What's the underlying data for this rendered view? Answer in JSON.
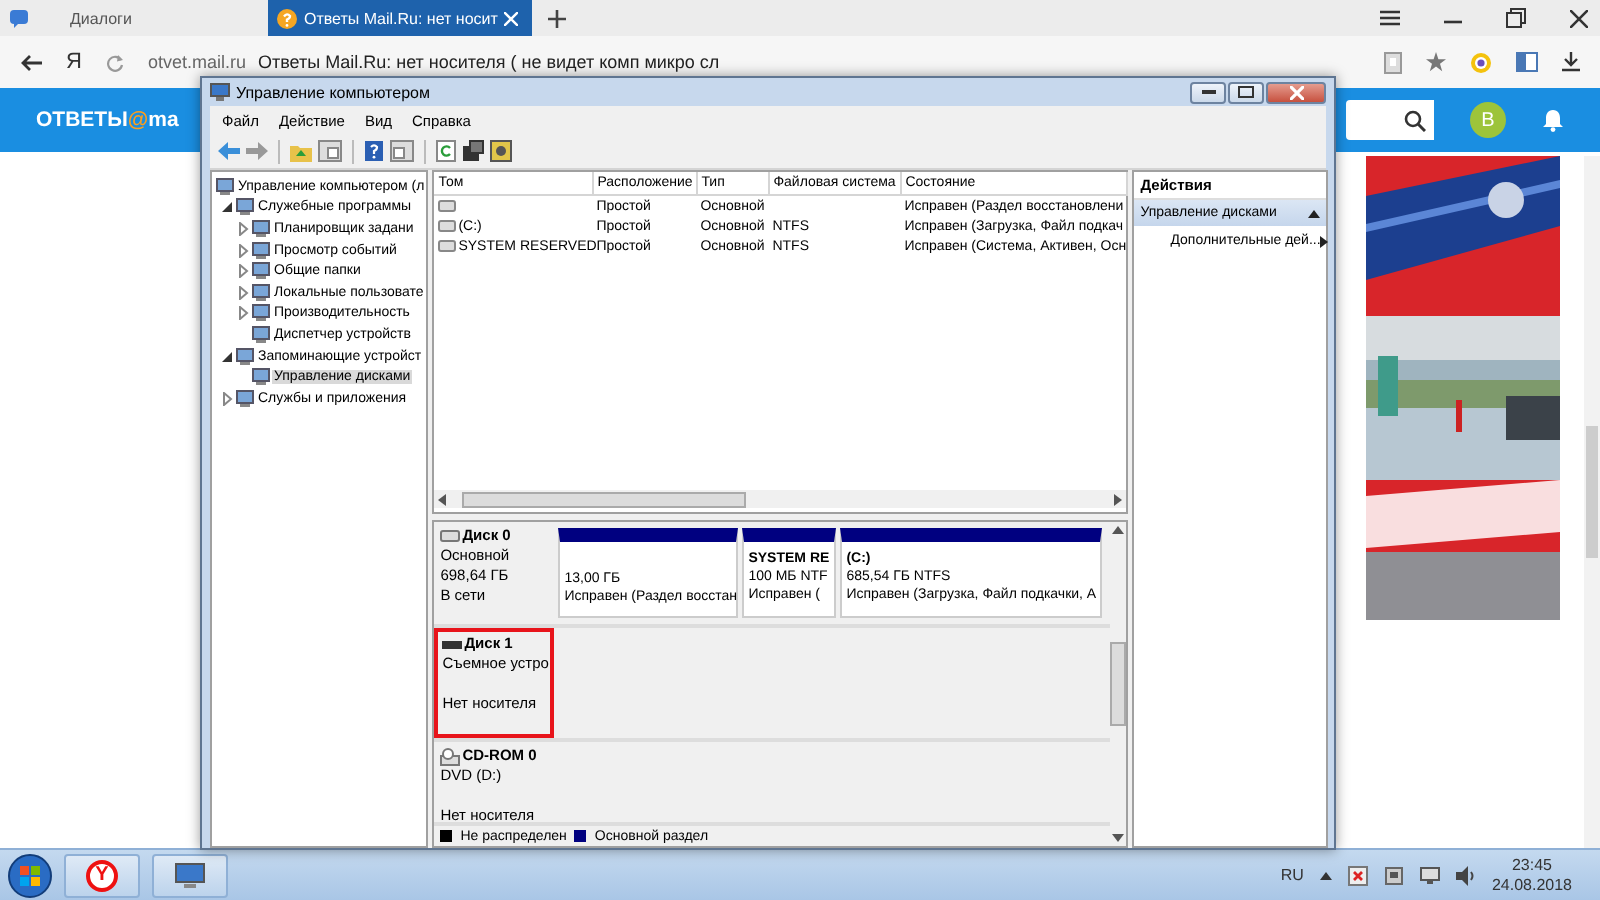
{
  "browser": {
    "tabs": [
      {
        "label": "Диалоги",
        "selected": false
      },
      {
        "label": "Ответы Mail.Ru: нет носит",
        "selected": true
      }
    ],
    "logo_letter": "Я",
    "domain": "otvet.mail.ru",
    "page_title": "Ответы Mail.Ru: нет носителя ( не видет комп микро сл",
    "site_logo": [
      "ОТВЕТЫ",
      "@",
      "ma"
    ],
    "avatar": "В"
  },
  "window": {
    "title": "Управление компьютером",
    "menu": [
      "Файл",
      "Действие",
      "Вид",
      "Справка"
    ],
    "tree": [
      {
        "label": "Управление компьютером (л",
        "selected": false,
        "children": [
          {
            "label": "Служебные программы",
            "expanded": true,
            "selected": false,
            "children": [
              {
                "label": "Планировщик задани",
                "expanded": false,
                "selected": false
              },
              {
                "label": "Просмотр событий",
                "expanded": false,
                "selected": false
              },
              {
                "label": "Общие папки",
                "expanded": false,
                "selected": false
              },
              {
                "label": "Локальные пользовате",
                "expanded": false,
                "selected": false
              },
              {
                "label": "Производительность",
                "expanded": false,
                "selected": false
              },
              {
                "label": "Диспетчер устройств",
                "selected": false
              }
            ]
          },
          {
            "label": "Запоминающие устройст",
            "expanded": true,
            "selected": false,
            "children": [
              {
                "label": "Управление дисками",
                "selected": true
              }
            ]
          },
          {
            "label": "Службы и приложения",
            "expanded": false,
            "selected": false
          }
        ]
      }
    ],
    "volumes": {
      "columns": [
        "Том",
        "Расположение",
        "Тип",
        "Файловая система",
        "Состояние"
      ],
      "rows": [
        {
          "layout": "Простой",
          "type": "Основной",
          "status": "Исправен (Раздел восстановлени"
        },
        {
          "volume": "(C:)",
          "layout": "Простой",
          "type": "Основной",
          "fs": "NTFS",
          "status": "Исправен (Загрузка, Файл подкач"
        },
        {
          "volume": "SYSTEM RESERVED",
          "layout": "Простой",
          "type": "Основной",
          "fs": "NTFS",
          "status": "Исправен (Система, Активен, Осн"
        }
      ]
    },
    "disks": [
      {
        "kind": "disk",
        "name": "Диск 0",
        "type": "Основной",
        "size": "698,64 ГБ",
        "state": "В сети",
        "highlighted": false,
        "partitions": [
          {
            "size": "13,00 ГБ",
            "status": "Исправен (Раздел восстан"
          },
          {
            "name": "SYSTEM RE",
            "size": "100 МБ NTF",
            "status": "Исправен ("
          },
          {
            "name": "(C:)",
            "size": "685,54 ГБ NTFS",
            "status": "Исправен (Загрузка, Файл подкачки, А"
          }
        ]
      },
      {
        "kind": "removable",
        "name": "Диск 1",
        "type": "Съемное устро",
        "state": "Нет носителя",
        "highlighted": true
      },
      {
        "kind": "cdrom",
        "name": "CD-ROM 0",
        "type": "DVD (D:)",
        "state": "Нет носителя",
        "highlighted": false
      }
    ],
    "legend": [
      {
        "label": "Не распределен",
        "color": "#000000"
      },
      {
        "label": "Основной раздел",
        "color": "#000080"
      }
    ],
    "actions": {
      "title": "Действия",
      "section": "Управление дисками",
      "items": [
        "Дополнительные дей..."
      ]
    }
  },
  "taskbar": {
    "browser_badge": "Y",
    "language": "RU",
    "time": "23:45",
    "date": "24.08.2018"
  }
}
